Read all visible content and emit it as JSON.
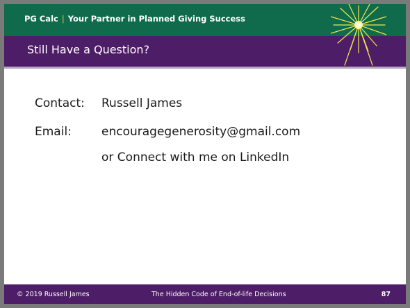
{
  "header": {
    "brand": "PG Calc",
    "separator": "|",
    "tagline": "Your Partner in Planned Giving Success"
  },
  "slide": {
    "title": "Still Have a Question?",
    "contact_label": "Contact:",
    "contact_value": "Russell James",
    "email_label": "Email:",
    "email_value": "encouragegenerosity@gmail.com",
    "linkedin_text": "or Connect with me on LinkedIn"
  },
  "footer": {
    "copyright": "© 2019 Russell James",
    "presentation_title": "The Hidden Code of End-of-life Decisions",
    "page_number": "87"
  },
  "colors": {
    "header_green": "#0f6b4c",
    "title_purple": "#4e1d67",
    "burst_yellow": "#f5e84a"
  }
}
